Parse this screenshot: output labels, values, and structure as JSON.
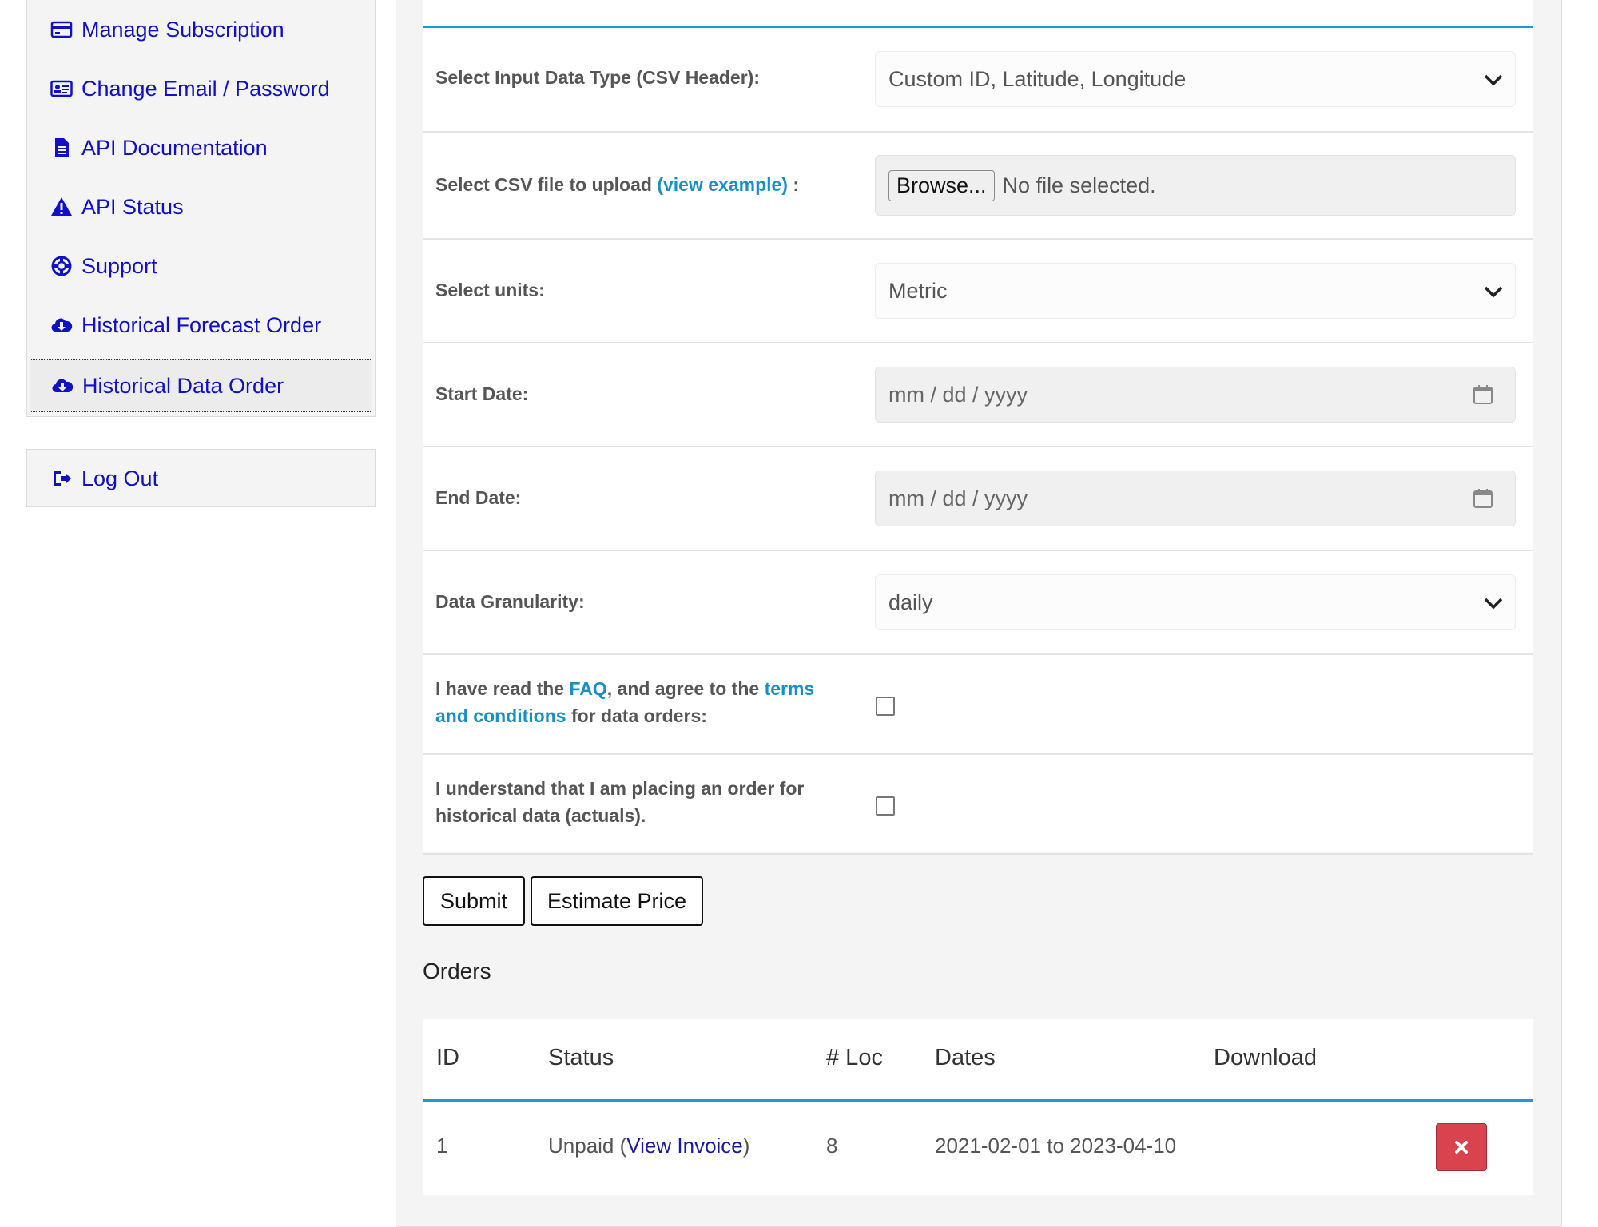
{
  "sidebar": {
    "items": [
      {
        "label": "Manage Subscription",
        "icon": "credit-card-icon"
      },
      {
        "label": "Change Email / Password",
        "icon": "id-card-icon"
      },
      {
        "label": "API Documentation",
        "icon": "document-icon"
      },
      {
        "label": "API Status",
        "icon": "warning-icon"
      },
      {
        "label": "Support",
        "icon": "life-ring-icon"
      },
      {
        "label": "Historical Forecast Order",
        "icon": "cloud-download-icon"
      },
      {
        "label": "Historical Data Order",
        "icon": "cloud-download-icon",
        "active": true
      }
    ],
    "logout": {
      "label": "Log Out",
      "icon": "sign-out-icon"
    }
  },
  "form": {
    "input_type": {
      "label": "Select Input Data Type (CSV Header):",
      "value": "Custom ID, Latitude, Longitude"
    },
    "csv_upload": {
      "label_prefix": "Select CSV file to upload",
      "link": "(view example)",
      "label_suffix": " :",
      "button": "Browse...",
      "status": "No file selected."
    },
    "units": {
      "label": "Select units:",
      "value": "Metric"
    },
    "start_date": {
      "label": "Start Date:",
      "placeholder": "mm / dd / yyyy"
    },
    "end_date": {
      "label": "End Date:",
      "placeholder": "mm / dd / yyyy"
    },
    "granularity": {
      "label": "Data Granularity:",
      "value": "daily"
    },
    "agree_terms": {
      "p1": "I have read the ",
      "faq": "FAQ",
      "p2": ", and agree to the ",
      "terms": "terms and conditions",
      "p3": " for data orders:"
    },
    "understand": {
      "label": "I understand that I am placing an order for historical data (actuals)."
    }
  },
  "buttons": {
    "submit": "Submit",
    "estimate": "Estimate Price"
  },
  "orders": {
    "heading": "Orders",
    "columns": [
      "ID",
      "Status",
      "# Loc",
      "Dates",
      "Download"
    ],
    "rows": [
      {
        "id": "1",
        "status_prefix": "Unpaid (",
        "status_link": "View Invoice",
        "status_suffix": ")",
        "loc": "8",
        "dates": "2021-02-01 to 2023-04-10"
      }
    ]
  },
  "colors": {
    "link": "#1010c8",
    "accent": "#1a9ad6",
    "danger": "#d9434e"
  }
}
